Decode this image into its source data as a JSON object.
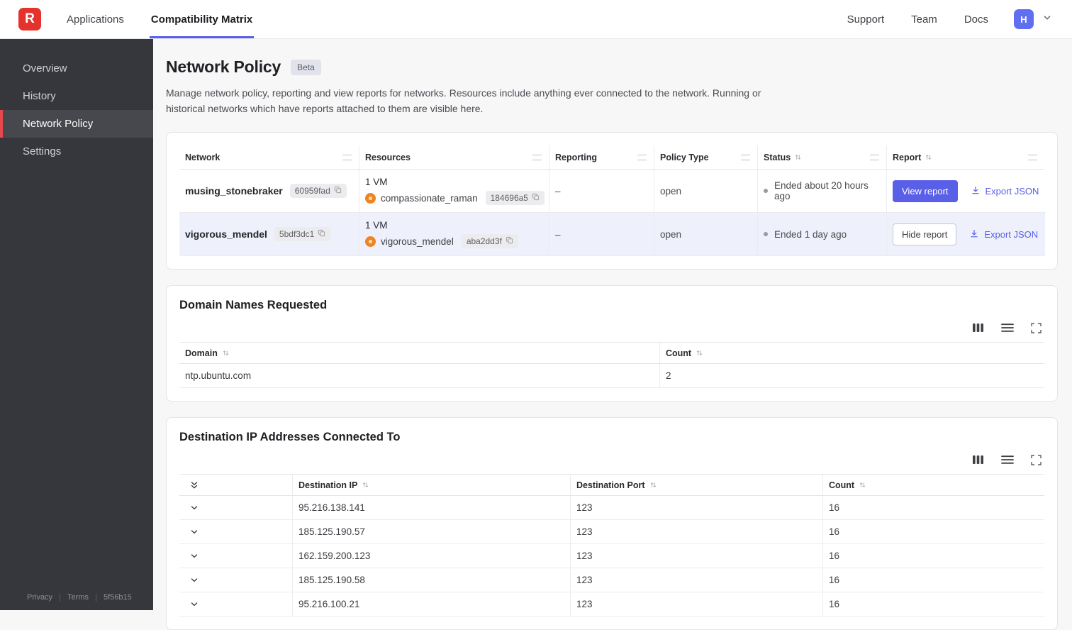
{
  "header": {
    "logo": "R",
    "nav": [
      {
        "label": "Applications"
      },
      {
        "label": "Compatibility Matrix"
      }
    ],
    "right_nav": [
      "Support",
      "Team",
      "Docs"
    ],
    "avatar": "H"
  },
  "sidebar": {
    "items": [
      {
        "label": "Overview"
      },
      {
        "label": "History"
      },
      {
        "label": "Network Policy"
      },
      {
        "label": "Settings"
      }
    ],
    "footer": {
      "privacy": "Privacy",
      "terms": "Terms",
      "version": "5f56b15"
    }
  },
  "page": {
    "title": "Network Policy",
    "badge": "Beta",
    "description": "Manage network policy, reporting and view reports for networks. Resources include anything ever connected to the network. Running or historical networks which have reports attached to them are visible here."
  },
  "networks_table": {
    "columns": [
      "Network",
      "Resources",
      "Reporting",
      "Policy Type",
      "Status",
      "Report"
    ],
    "rows": [
      {
        "network": "musing_stonebraker",
        "network_hash": "60959fad",
        "vm_count": "1 VM",
        "resource_name": "compassionate_raman",
        "resource_hash": "184696a5",
        "reporting": "–",
        "policy_type": "open",
        "status": "Ended about 20 hours ago",
        "report_button": "View report",
        "export_label": "Export JSON"
      },
      {
        "network": "vigorous_mendel",
        "network_hash": "5bdf3dc1",
        "vm_count": "1 VM",
        "resource_name": "vigorous_mendel",
        "resource_hash": "aba2dd3f",
        "reporting": "–",
        "policy_type": "open",
        "status": "Ended 1 day ago",
        "report_button": "Hide report",
        "export_label": "Export JSON"
      }
    ]
  },
  "domains_card": {
    "title": "Domain Names Requested",
    "columns": [
      "Domain",
      "Count"
    ],
    "rows": [
      {
        "domain": "ntp.ubuntu.com",
        "count": "2"
      }
    ]
  },
  "destinations_card": {
    "title": "Destination IP Addresses Connected To",
    "columns": [
      "Destination IP",
      "Destination Port",
      "Count"
    ],
    "rows": [
      {
        "ip": "95.216.138.141",
        "port": "123",
        "count": "16"
      },
      {
        "ip": "185.125.190.57",
        "port": "123",
        "count": "16"
      },
      {
        "ip": "162.159.200.123",
        "port": "123",
        "count": "16"
      },
      {
        "ip": "185.125.190.58",
        "port": "123",
        "count": "16"
      },
      {
        "ip": "95.216.100.21",
        "port": "123",
        "count": "16"
      }
    ]
  }
}
